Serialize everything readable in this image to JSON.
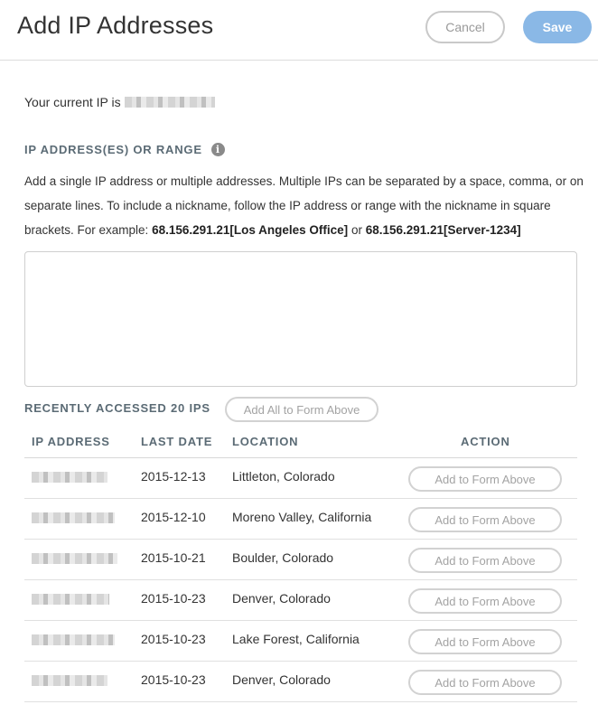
{
  "header": {
    "title": "Add IP Addresses",
    "cancel_label": "Cancel",
    "save_label": "Save"
  },
  "current_ip": {
    "prefix": "Your current IP is",
    "value_redacted": true
  },
  "ip_section": {
    "label": "IP ADDRESS(ES) OR RANGE",
    "info_icon": "info-icon",
    "description_1": "Add a single IP address or multiple addresses. Multiple IPs can be separated by a space, comma, or on separate lines. To include a nickname, follow the IP address or range with the nickname in square brackets. For example: ",
    "example_1_ip": "68.156.291.21",
    "example_1_nick": "[Los Angeles Office]",
    "description_or": " or ",
    "example_2_ip": "68.156.291.21",
    "example_2_nick": "[Server-1234]",
    "textarea_value": "",
    "textarea_placeholder": ""
  },
  "recent": {
    "label": "RECENTLY ACCESSED 20 IPS",
    "add_all_label": "Add All to Form Above",
    "columns": {
      "ip": "IP ADDRESS",
      "date": "LAST DATE",
      "location": "LOCATION",
      "action": "ACTION"
    },
    "rows": [
      {
        "ip_redacted": true,
        "date": "2015-12-13",
        "location": "Littleton, Colorado",
        "action": "Add to Form Above"
      },
      {
        "ip_redacted": true,
        "date": "2015-12-10",
        "location": "Moreno Valley, California",
        "action": "Add to Form Above"
      },
      {
        "ip_redacted": true,
        "date": "2015-10-21",
        "location": "Boulder, Colorado",
        "action": "Add to Form Above"
      },
      {
        "ip_redacted": true,
        "date": "2015-10-23",
        "location": "Denver, Colorado",
        "action": "Add to Form Above"
      },
      {
        "ip_redacted": true,
        "date": "2015-10-23",
        "location": "Lake Forest, California",
        "action": "Add to Form Above"
      },
      {
        "ip_redacted": true,
        "date": "2015-10-23",
        "location": "Denver, Colorado",
        "action": "Add to Form Above"
      }
    ]
  },
  "colors": {
    "save_bg": "#8ab8e6",
    "label_color": "#5b6b75",
    "border": "#d2d2d2"
  }
}
